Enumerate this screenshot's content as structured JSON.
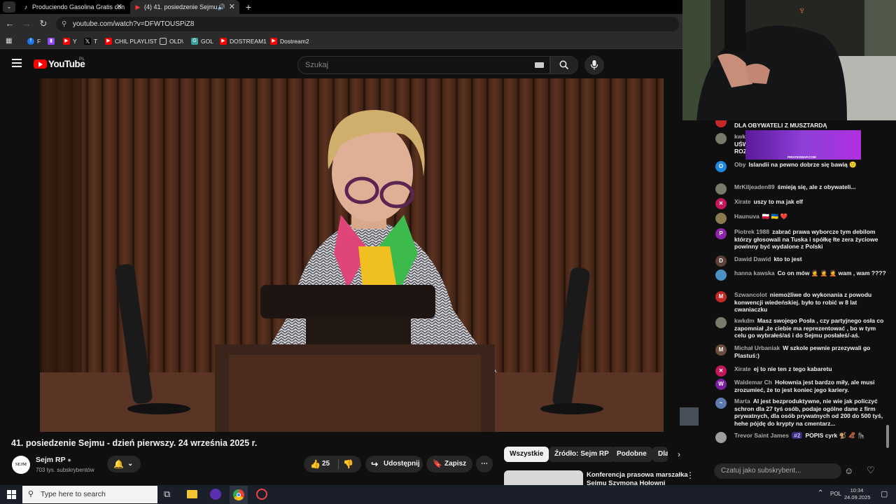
{
  "browser": {
    "tabs": [
      {
        "title": "Produciendo Gasolina Gratis con"
      },
      {
        "title": "(4) 41. posiedzenie Sejmu -"
      }
    ],
    "new_tab": "+",
    "address": "youtube.com/watch?v=DFWTOUSPiZ8",
    "bookmarks": [
      {
        "label": "F",
        "icon": "facebook-icon",
        "color": "#1877f2"
      },
      {
        "label": "",
        "icon": "twitch-icon",
        "color": "#9146ff"
      },
      {
        "label": "Y",
        "icon": "youtube-icon",
        "color": "#ff0000"
      },
      {
        "label": "T",
        "icon": "x-icon",
        "color": "#000000"
      },
      {
        "label": "CHIL PLAYLIST",
        "icon": "youtube-icon",
        "color": "#ff0000"
      },
      {
        "label": "OLD\\",
        "icon": "folder-icon",
        "color": "#cccccc"
      },
      {
        "label": "GOL",
        "icon": "gol-icon",
        "color": "#3aa0a0"
      },
      {
        "label": "DOSTREAM1",
        "icon": "youtube-icon",
        "color": "#ff0000"
      },
      {
        "label": "Dostream2",
        "icon": "youtube-icon",
        "color": "#ff0000"
      }
    ]
  },
  "youtube": {
    "logo_text": "YouTube",
    "logo_region": "PL",
    "search_placeholder": "Szukaj",
    "video_title": "41. posiedzenie Sejmu - dzień pierwszy. 24 września 2025 r.",
    "channel_name": "Sejm RP",
    "channel_avatar": "SEJM",
    "subscribers": "703 tys. subskrybentów",
    "likes": "25",
    "share_label": "Udostępnij",
    "save_label": "Zapisz",
    "chips": [
      "Wszystkie",
      "Źródło: Sejm RP",
      "Podobne",
      "Dla"
    ],
    "related_title_line1": "Konferencja prasowa marszałka",
    "related_title_line2": "Sejmu Szymona Hołowni"
  },
  "chat": {
    "top_partial": "DLA OBYWATELI Z MUSZTARDĄ",
    "overlay_author": "kwk",
    "overlay_lines": [
      "UŚW",
      "ROZ"
    ],
    "overlay_ad_text": "PIRATESWAP.COM",
    "messages": [
      {
        "initial": "O",
        "color": "#1e88e5",
        "author": "Oby",
        "text": "Islandii na pewno dobrze się bawią 🙂"
      },
      {
        "initial": "",
        "color": "#7a7a6a",
        "author": "MrKiljeaden89",
        "text": "śmieją się, ale z obywateli..."
      },
      {
        "initial": "✕",
        "color": "#c2185b",
        "author": "Xirate",
        "text": "uszy to ma jak elf"
      },
      {
        "initial": "",
        "color": "#8a7a50",
        "author": "Haunuva",
        "text": "🇵🇱 🇺🇦 ❤️"
      },
      {
        "initial": "P",
        "color": "#8e24aa",
        "author": "Piotrek 1988",
        "text": "zabrać prawa wyborcze tym debilom którzy głosowali na Tuska i spółkę łte zera życiowe powinny być wydalone z Polski"
      },
      {
        "initial": "D",
        "color": "#5d4037",
        "author": "Dawid Dawid",
        "text": "kto to jest"
      },
      {
        "initial": "",
        "color": "#4a90c2",
        "author": "hanna kawska",
        "text": "Co on mów 🤦 🤦 🤦 wam , wam ????"
      },
      {
        "initial": "M",
        "color": "#c62828",
        "author": "Szwancolot",
        "text": "niemożliwe do wykonania z powodu konwencji wiedeńskiej. było to robić w 8 lat cwaniaczku"
      },
      {
        "initial": "",
        "color": "#7a7a6a",
        "author": "kwkdm",
        "text": "Masz swojego Posła , czy partyjnego osła co zapomniał ,że ciebie ma reprezentować , bo w tym celu go wybrałeś/aś i do Sejmu posłałeś/-aś."
      },
      {
        "initial": "M",
        "color": "#6d4c41",
        "author": "Michał Urbaniak",
        "text": "W szkole pewnie przezywali go Plastuś:)"
      },
      {
        "initial": "✕",
        "color": "#c2185b",
        "author": "Xirate",
        "text": "ej to nie ten z tego kabaretu"
      },
      {
        "initial": "W",
        "color": "#7b1fa2",
        "author": "Waldemar Ch",
        "text": "Hołownia jest bardzo miły, ale musi zrozumieć, że to jest koniec jego kariery."
      },
      {
        "initial": "~",
        "color": "#5c7ab0",
        "author": "Marta",
        "text": "AI jest bezproduktywne, nie wie jak policzyć schron dla 27 tyś osób, podaje ogólne dane z firm prywatnych, dla osób prywatnych od 200 do 500 tyś, hehe pójdę do krypty na cmentarz..."
      },
      {
        "initial": "",
        "color": "#9e9e9e",
        "author": "Trevor Saint James",
        "badge": "#2",
        "text": "POPIS cyrk 🐒 🦧 🦍"
      }
    ],
    "input_placeholder": "Czatuj jako subskrybent..."
  },
  "taskbar": {
    "search_placeholder": "Type here to search",
    "language": "POL",
    "time": "10:34",
    "date": "24.09.2025"
  },
  "colors": {
    "accent_red": "#ff0000",
    "background": "#0f0f0f",
    "chip_bg": "#272727"
  }
}
